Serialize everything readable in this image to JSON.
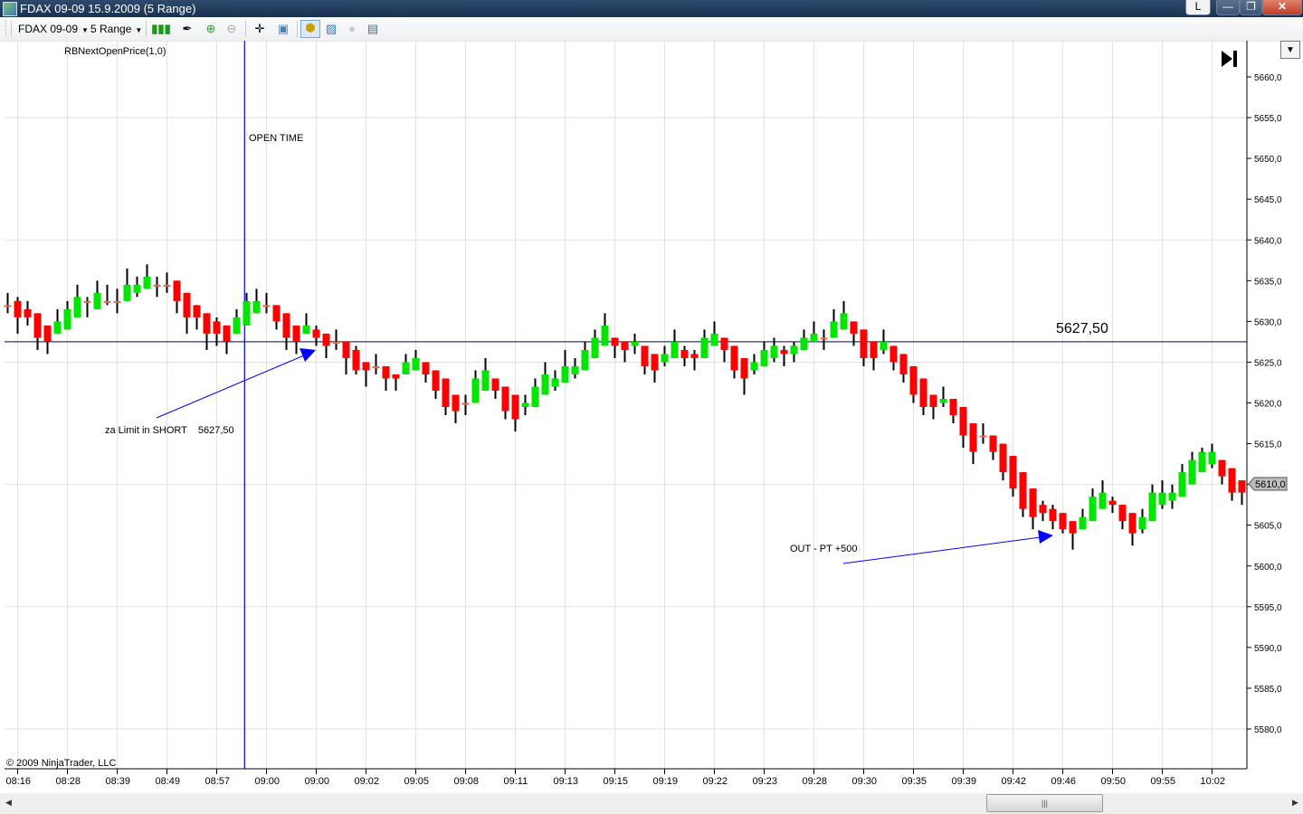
{
  "window": {
    "title": "FDAX 09-09  15.9.2009 (5 Range)",
    "btn_l": "L",
    "btn_min": "—",
    "btn_max": "❐",
    "btn_close": "✕"
  },
  "toolbar": {
    "instrument": "FDAX 09-09",
    "interval": "5 Range",
    "icons": [
      "candlestick-icon",
      "pencil-icon",
      "zoom-in-icon",
      "zoom-out-icon",
      "crosshair-icon",
      "properties-icon",
      "strategy-icon",
      "indicator-icon",
      "disabled-circle-icon",
      "data-box-icon"
    ]
  },
  "chart": {
    "indicator_label": "RBNextOpenPrice(1,0)",
    "open_time_label": "OPEN TIME",
    "entry_note": "za Limit in SHORT    5627,50",
    "exit_note": "OUT - PT +500",
    "level_label": "5627,50",
    "last_price_label": "5610,0",
    "copyright": "© 2009 NinjaTrader, LLC",
    "colors": {
      "up": "#00e600",
      "down": "#ff0000",
      "wick": "#000000",
      "annotation": "#0000cc"
    }
  },
  "chart_data": {
    "type": "candlestick",
    "title": "FDAX 09-09  15.9.2009 (5 Range)",
    "ohlc_order": [
      "open",
      "high",
      "low",
      "close"
    ],
    "candles": [
      [
        5632,
        5633.5,
        5631,
        5632
      ],
      [
        5632.5,
        5633,
        5628.5,
        5630.5
      ],
      [
        5631.5,
        5632.5,
        5629.5,
        5630.5
      ],
      [
        5631,
        5631,
        5626.5,
        5628
      ],
      [
        5629.5,
        5629.5,
        5626,
        5627.5
      ],
      [
        5628.5,
        5631.5,
        5628.5,
        5630
      ],
      [
        5629,
        5632.5,
        5629,
        5631.5
      ],
      [
        5630.5,
        5634.5,
        5630.5,
        5633
      ],
      [
        5632.5,
        5633,
        5630.5,
        5632.5
      ],
      [
        5631.5,
        5635,
        5631.5,
        5633.5
      ],
      [
        5632.5,
        5634.5,
        5632,
        5632.5
      ],
      [
        5632.5,
        5634,
        5631,
        5632.5
      ],
      [
        5632.5,
        5636.5,
        5632.5,
        5634.5
      ],
      [
        5633.5,
        5635.5,
        5633,
        5634.5
      ],
      [
        5634,
        5637,
        5634,
        5635.5
      ],
      [
        5634.5,
        5635.5,
        5633,
        5634.5
      ],
      [
        5634.5,
        5636,
        5633.5,
        5634.5
      ],
      [
        5635,
        5635,
        5631,
        5632.5
      ],
      [
        5633.5,
        5633.5,
        5628.5,
        5630.5
      ],
      [
        5632,
        5632,
        5629,
        5630.5
      ],
      [
        5631,
        5631,
        5626.5,
        5628.5
      ],
      [
        5630,
        5630.5,
        5627,
        5628.5
      ],
      [
        5629.5,
        5629.5,
        5626,
        5627.5
      ],
      [
        5628.5,
        5631.5,
        5628.5,
        5630.5
      ],
      [
        5629.5,
        5633.5,
        5629.5,
        5632.5
      ],
      [
        5631,
        5634,
        5631,
        5632.5
      ],
      [
        5632,
        5633.5,
        5631,
        5632
      ],
      [
        5632,
        5632,
        5629,
        5630
      ],
      [
        5631,
        5631,
        5626.5,
        5628
      ],
      [
        5629.5,
        5629.5,
        5626,
        5627.5
      ],
      [
        5628.5,
        5631,
        5628.5,
        5629.5
      ],
      [
        5629,
        5629.5,
        5627,
        5628
      ],
      [
        5628.5,
        5628.5,
        5625.5,
        5627
      ],
      [
        5627.5,
        5629,
        5626.5,
        5627.5
      ],
      [
        5627.5,
        5627.5,
        5623.5,
        5625.5
      ],
      [
        5626.5,
        5627,
        5623.5,
        5624
      ],
      [
        5625,
        5625,
        5622,
        5624
      ],
      [
        5624.5,
        5626,
        5623.5,
        5624.5
      ],
      [
        5624.5,
        5624.5,
        5621.5,
        5623
      ],
      [
        5623.5,
        5623.5,
        5621.5,
        5623
      ],
      [
        5623.5,
        5626,
        5623.5,
        5625
      ],
      [
        5624,
        5626.5,
        5624,
        5625.5
      ],
      [
        5625,
        5625,
        5622.5,
        5623.5
      ],
      [
        5624,
        5624,
        5620.5,
        5621.5
      ],
      [
        5623,
        5623,
        5618.5,
        5619.5
      ],
      [
        5621,
        5621,
        5617.5,
        5619
      ],
      [
        5620,
        5621,
        5618.5,
        5620
      ],
      [
        5620,
        5624,
        5620,
        5623
      ],
      [
        5621.5,
        5625.5,
        5621.5,
        5624
      ],
      [
        5623,
        5623,
        5620.5,
        5621.5
      ],
      [
        5622,
        5622,
        5618,
        5619
      ],
      [
        5621,
        5621,
        5616.5,
        5618
      ],
      [
        5619.5,
        5621,
        5618.5,
        5620
      ],
      [
        5619.5,
        5623,
        5619.5,
        5622
      ],
      [
        5621,
        5625,
        5621,
        5623.5
      ],
      [
        5622,
        5624,
        5621.5,
        5623
      ],
      [
        5622.5,
        5626.5,
        5622.5,
        5624.5
      ],
      [
        5623.5,
        5625.5,
        5623,
        5624.5
      ],
      [
        5624,
        5627.5,
        5624,
        5626.5
      ],
      [
        5625.5,
        5629,
        5625.5,
        5628
      ],
      [
        5627,
        5631,
        5627,
        5629.5
      ],
      [
        5628,
        5628,
        5625.5,
        5627
      ],
      [
        5627.5,
        5627.5,
        5625,
        5626.5
      ],
      [
        5627,
        5628.5,
        5626,
        5627.5
      ],
      [
        5627,
        5627,
        5623.5,
        5624.5
      ],
      [
        5626,
        5626,
        5622.5,
        5624
      ],
      [
        5625,
        5627,
        5624.5,
        5626
      ],
      [
        5625.5,
        5629,
        5625.5,
        5627.5
      ],
      [
        5626.5,
        5627,
        5624.5,
        5625.5
      ],
      [
        5626,
        5626.5,
        5624,
        5625.5
      ],
      [
        5625.5,
        5629,
        5625.5,
        5628
      ],
      [
        5627,
        5630,
        5627,
        5628.5
      ],
      [
        5628,
        5628,
        5625,
        5626.5
      ],
      [
        5627,
        5627,
        5623,
        5624
      ],
      [
        5625.5,
        5625.5,
        5621,
        5623
      ],
      [
        5624,
        5626,
        5623.5,
        5625
      ],
      [
        5624.5,
        5627.5,
        5624.5,
        5626.5
      ],
      [
        5625.5,
        5628,
        5625,
        5627
      ],
      [
        5626.5,
        5627,
        5624.5,
        5626
      ],
      [
        5626,
        5627.5,
        5625,
        5627
      ],
      [
        5626.5,
        5629,
        5626.5,
        5628
      ],
      [
        5627.5,
        5630,
        5627.5,
        5628.5
      ],
      [
        5628,
        5629,
        5626.5,
        5628
      ],
      [
        5628,
        5631.5,
        5628,
        5630
      ],
      [
        5629,
        5632.5,
        5629,
        5631
      ],
      [
        5630,
        5630,
        5627,
        5628.5
      ],
      [
        5629,
        5629,
        5624.5,
        5625.5
      ],
      [
        5627.5,
        5627.5,
        5624,
        5625.5
      ],
      [
        5626.5,
        5629,
        5626,
        5627.5
      ],
      [
        5627,
        5627,
        5624,
        5625
      ],
      [
        5626,
        5626,
        5622.5,
        5623.5
      ],
      [
        5624.5,
        5624.5,
        5620,
        5621
      ],
      [
        5623,
        5623,
        5618.5,
        5619.5
      ],
      [
        5621,
        5621,
        5618,
        5619.5
      ],
      [
        5620,
        5622,
        5619.5,
        5620.5
      ],
      [
        5620.5,
        5620.5,
        5617.5,
        5618.5
      ],
      [
        5619.5,
        5619.5,
        5614.5,
        5616
      ],
      [
        5617.5,
        5617.5,
        5612.5,
        5614
      ],
      [
        5616,
        5617.5,
        5615,
        5616
      ],
      [
        5616,
        5616,
        5613,
        5614
      ],
      [
        5615,
        5615,
        5610.5,
        5611.5
      ],
      [
        5613.5,
        5613.5,
        5608.5,
        5609.5
      ],
      [
        5611.5,
        5611.5,
        5606,
        5607
      ],
      [
        5609.5,
        5609.5,
        5604.5,
        5606
      ],
      [
        5607.5,
        5608,
        5605.5,
        5606.5
      ],
      [
        5607,
        5607.5,
        5604.5,
        5605.5
      ],
      [
        5606.5,
        5606.5,
        5604,
        5604.5
      ],
      [
        5605.5,
        5605.5,
        5602,
        5604
      ],
      [
        5604.5,
        5607,
        5604.5,
        5606
      ],
      [
        5605.5,
        5609.5,
        5605.5,
        5608.5
      ],
      [
        5607,
        5610.5,
        5607,
        5609
      ],
      [
        5608,
        5608.5,
        5606.5,
        5607.5
      ],
      [
        5607.5,
        5607.5,
        5604.5,
        5605.5
      ],
      [
        5606.5,
        5606.5,
        5602.5,
        5604
      ],
      [
        5604.5,
        5607,
        5604,
        5606
      ],
      [
        5605.5,
        5610,
        5605.5,
        5609
      ],
      [
        5607.5,
        5610.5,
        5607,
        5609
      ],
      [
        5608,
        5610,
        5607,
        5609
      ],
      [
        5608.5,
        5612.5,
        5608.5,
        5611.5
      ],
      [
        5610,
        5614,
        5610,
        5613
      ],
      [
        5611.5,
        5614.5,
        5611.5,
        5614
      ],
      [
        5612.5,
        5615,
        5612,
        5614
      ],
      [
        5613,
        5613,
        5610,
        5611
      ],
      [
        5612,
        5612,
        5608,
        5609
      ],
      [
        5610.5,
        5610.5,
        5607.5,
        5609
      ]
    ],
    "x_tick_labels": [
      "08:16",
      "08:28",
      "08:39",
      "08:49",
      "08:57",
      "09:00",
      "09:00",
      "09:02",
      "09:05",
      "09:08",
      "09:11",
      "09:13",
      "09:15",
      "09:19",
      "09:22",
      "09:23",
      "09:28",
      "09:30",
      "09:35",
      "09:39",
      "09:42",
      "09:46",
      "09:50",
      "09:55",
      "10:02"
    ],
    "x_tick_every_n_bars": 5,
    "x_tick_first_bar": 1,
    "y_ticks": [
      5660,
      5655,
      5650,
      5645,
      5640,
      5635,
      5630,
      5625,
      5620,
      5615,
      5610,
      5605,
      5600,
      5595,
      5590,
      5585,
      5580
    ],
    "y_tick_labels": [
      "5660,0",
      "5655,0",
      "5650,0",
      "5645,0",
      "5640,0",
      "5635,0",
      "5630,0",
      "5625,0",
      "5620,0",
      "5615,0",
      "5610,0",
      "5605,0",
      "5600,0",
      "5595,0",
      "5590,0",
      "5585,0",
      "5580,0"
    ],
    "ylim": [
      5576.5,
      5664
    ],
    "horizontal_line_price": 5627.5,
    "open_time_bar": 23.8,
    "last_price": 5610.0,
    "grid": true,
    "xlabel": "",
    "ylabel": ""
  }
}
